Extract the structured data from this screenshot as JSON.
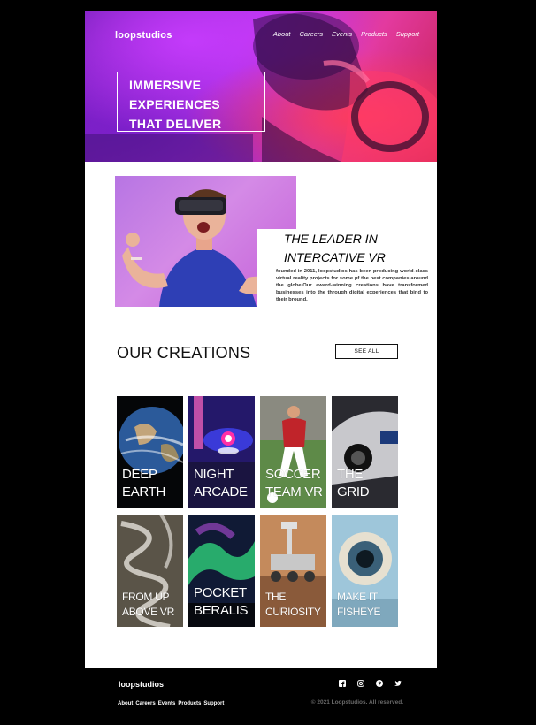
{
  "header": {
    "logo": "loopstudios",
    "nav": [
      "About",
      "Careers",
      "Events",
      "Products",
      "Support"
    ],
    "hero_lines": [
      "IMMERSIVE",
      "EXPERIENCES",
      "THAT DELIVER"
    ]
  },
  "leader": {
    "title_lines": [
      "THE LEADER IN",
      "INTERCATIVE VR"
    ],
    "text": "founded in 2011, loopstudios has been producing world-class virtual reality projects for some pf the best companies around the globe.Our award-winning creations have transformed businesses into the through digital experiences that bind to their bround."
  },
  "creations": {
    "title": "OUR CREATIONS",
    "see_all": "SEE ALL",
    "cards": [
      {
        "lines": [
          "DEEP",
          "EARTH"
        ]
      },
      {
        "lines": [
          "NIGHT",
          "ARCADE"
        ]
      },
      {
        "lines": [
          "SOCCER",
          "TEAM VR"
        ]
      },
      {
        "lines": [
          "THE",
          "GRID"
        ]
      },
      {
        "lines": [
          "FROM UP",
          "ABOVE VR"
        ]
      },
      {
        "lines": [
          "POCKET",
          "BERALIS"
        ]
      },
      {
        "lines": [
          "THE",
          "CURIOSITY"
        ]
      },
      {
        "lines": [
          "MAKE IT",
          "FISHEYE"
        ]
      }
    ]
  },
  "footer": {
    "logo": "loopstudios",
    "links": [
      "About",
      "Careers",
      "Events",
      "Products",
      "Support"
    ],
    "copyright": "© 2021 Loopstudios. All reserved.",
    "socials": [
      "facebook-icon",
      "instagram-icon",
      "pinterest-icon",
      "twitter-icon"
    ]
  }
}
